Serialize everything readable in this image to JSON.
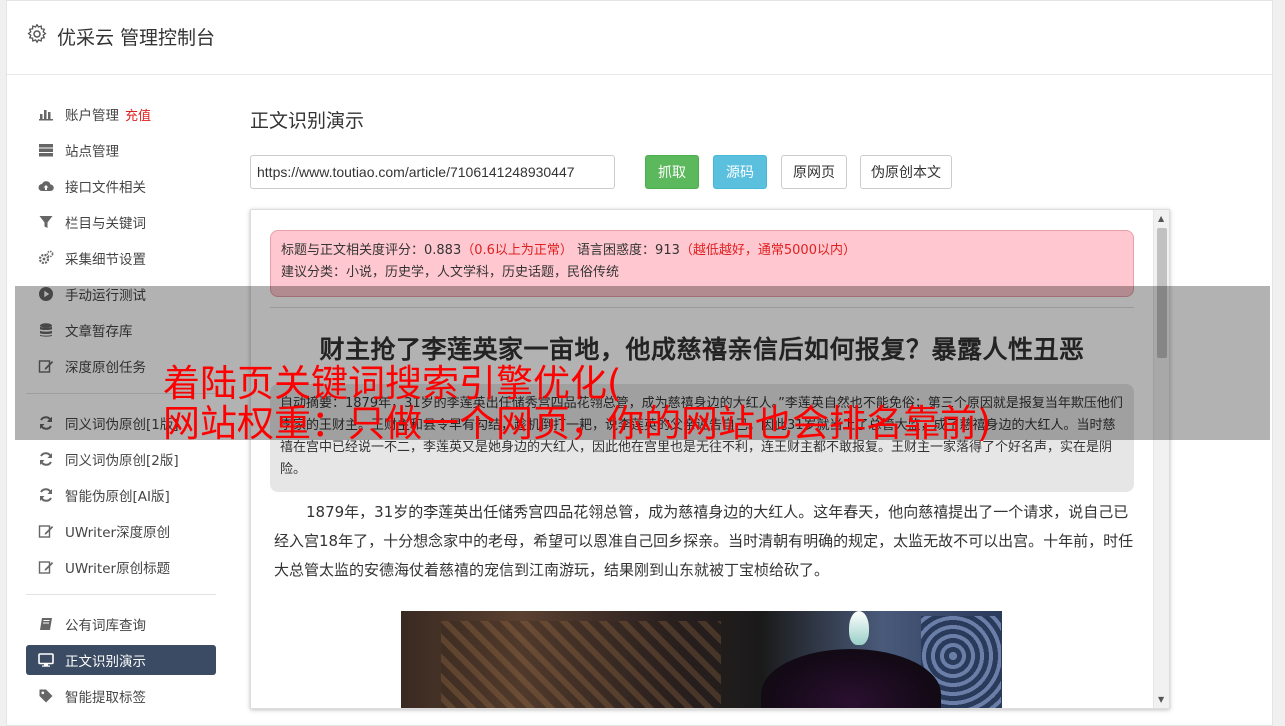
{
  "header": {
    "title": "优采云 管理控制台",
    "icon": "gear-icon"
  },
  "sidebar": {
    "items": [
      {
        "label": "账户管理",
        "extra": "充值",
        "icon": "bar-chart-icon"
      },
      {
        "label": "站点管理",
        "icon": "server-icon"
      },
      {
        "label": "接口文件相关",
        "icon": "cloud-upload-icon"
      },
      {
        "label": "栏目与关键词",
        "icon": "filter-icon"
      },
      {
        "label": "采集细节设置",
        "icon": "gears-icon"
      },
      {
        "label": "手动运行测试",
        "icon": "play-circle-icon"
      },
      {
        "label": "文章暂存库",
        "icon": "database-icon"
      },
      {
        "label": "深度原创任务",
        "icon": "edit-icon"
      },
      {
        "label": "同义词伪原创[1版]",
        "icon": "refresh-icon"
      },
      {
        "label": "同义词伪原创[2版]",
        "icon": "refresh-icon"
      },
      {
        "label": "智能伪原创[AI版]",
        "icon": "refresh-icon"
      },
      {
        "label": "UWriter深度原创",
        "icon": "edit-icon"
      },
      {
        "label": "UWriter原创标题",
        "icon": "edit-icon"
      },
      {
        "label": "公有词库查询",
        "icon": "book-icon"
      },
      {
        "label": "正文识别演示",
        "icon": "desktop-icon",
        "active": true
      },
      {
        "label": "智能提取标签",
        "icon": "tag-icon"
      }
    ]
  },
  "main": {
    "page_title": "正文识别演示",
    "url_value": "https://www.toutiao.com/article/7106141248930447",
    "buttons": {
      "fetch": "抓取",
      "source": "源码",
      "original": "原网页",
      "pseudo": "伪原创本文"
    }
  },
  "preview": {
    "alert": {
      "relevance_label": "标题与正文相关度评分：0.883",
      "relevance_note": "（0.6以上为正常）",
      "perplexity_label": "语言困惑度：913",
      "perplexity_note": "（越低越好，通常5000以内）",
      "categories": "建议分类：小说，历史学，人文学科，历史话题，民俗传统"
    },
    "article_title": "财主抢了李莲英家一亩地，他成慈禧亲信后如何报复？暴露人性丑恶",
    "summary": "自动摘要：1879年，31岁的李莲英出任储秀宫四品花翎总管，成为慈禧身边的大红人。”李莲英自然也不能免俗；第三个原因就是报复当年欺压他们李家的王财主。王财主和县令早有勾结，趁机倒打一耙，说李莲英的父亲诬告自己。因此31岁就当上了总管大监，成了慈禧身边的大红人。当时慈禧在宫中已经说一不二，李莲英又是她身边的大红人，因此他在宫里也是无往不利，连王财主都不敢报复。王财主一家落得了个好名声，实在是阴险。",
    "body": "1879年，31岁的李莲英出任储秀宫四品花翎总管，成为慈禧身边的大红人。这年春天，他向慈禧提出了一个请求，说自己已经入宫18年了，十分想念家中的老母，希望可以恩准自己回乡探亲。当时清朝有明确的规定，太监无故不可以出宫。十年前，时任大总管太监的安德海仗着慈禧的宠信到江南游玩，结果刚到山东就被丁宝桢给砍了。"
  },
  "overlay": {
    "line1": "着陆页关键词搜索引擎优化(",
    "line2": "网站权重：只做一个网页，你的网站也会排名靠前)"
  }
}
